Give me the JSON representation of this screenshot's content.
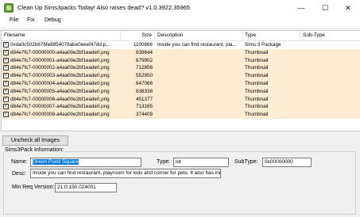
{
  "window": {
    "title": "Clean Up Sims3packs Today! Also raises dead? v1.0.3922.35965",
    "minimize": "—",
    "maximize": "☐",
    "close": "✕"
  },
  "menu": [
    "File",
    "Fix",
    "Debug"
  ],
  "grid": {
    "columns": [
      "Filename",
      "Size",
      "Description",
      "Type",
      "Sub-Type"
    ],
    "rows": [
      {
        "checked": true,
        "filename": "0xda0c502b676fe8854078abe0eeef47dd.p...",
        "size": "1100866",
        "description": "Inside you can find restaurant, pla...",
        "type": "Sims 3 Package",
        "subtype": ""
      },
      {
        "checked": true,
        "filename": "d84e7fc7-00000000-a4aa00e2bf1eade0.png",
        "size": "639644",
        "description": "",
        "type": "Thumbnail",
        "subtype": ""
      },
      {
        "checked": true,
        "filename": "d84e7fc7-00000001-a4aa00e2bf1eade0.png",
        "size": "679902",
        "description": "",
        "type": "Thumbnail",
        "subtype": ""
      },
      {
        "checked": true,
        "filename": "d84e7fc7-00000002-a4aa00e2bf1eade0.png",
        "size": "712856",
        "description": "",
        "type": "Thumbnail",
        "subtype": ""
      },
      {
        "checked": true,
        "filename": "d84e7fc7-00000003-a4aa00e2bf1eade0.png",
        "size": "552950",
        "description": "",
        "type": "Thumbnail",
        "subtype": ""
      },
      {
        "checked": true,
        "filename": "d84e7fc7-00000004-a4aa00e2bf1eade0.png",
        "size": "647066",
        "description": "",
        "type": "Thumbnail",
        "subtype": ""
      },
      {
        "checked": true,
        "filename": "d84e7fc7-00000005-a4aa00e2bf1eade0.png",
        "size": "638338",
        "description": "",
        "type": "Thumbnail",
        "subtype": ""
      },
      {
        "checked": true,
        "filename": "d84e7fc7-00000006-a4aa00e2bf1eade0.png",
        "size": "451377",
        "description": "",
        "type": "Thumbnail",
        "subtype": ""
      },
      {
        "checked": true,
        "filename": "d84e7fc7-00000007-a4aa00e2bf1eade0.png",
        "size": "713165",
        "description": "",
        "type": "Thumbnail",
        "subtype": ""
      },
      {
        "checked": true,
        "filename": "d84e7fc7-00000008-a4aa00e2bf1eade0.png",
        "size": "374409",
        "description": "",
        "type": "Thumbnail",
        "subtype": ""
      }
    ]
  },
  "uncheck_button": "Uncheck all Images",
  "info": {
    "group_label": "Sims3Pack Information:",
    "name_label": "Name:",
    "name_value": "Green Pond Square",
    "type_label": "Type:",
    "type_value": "lot",
    "subtype_label": "SubType:",
    "subtype_value": "0x00000000",
    "desc_label": "Desc:",
    "desc_value": "Inside you can find restaurant, playroom for kids and corner for pets. It also has inde",
    "minreq_label": "Min Req Version:",
    "minreq_value": "21.0.150.024001"
  },
  "colors": {
    "row_highlight": "#fdebd3",
    "selection": "#0078d7"
  }
}
